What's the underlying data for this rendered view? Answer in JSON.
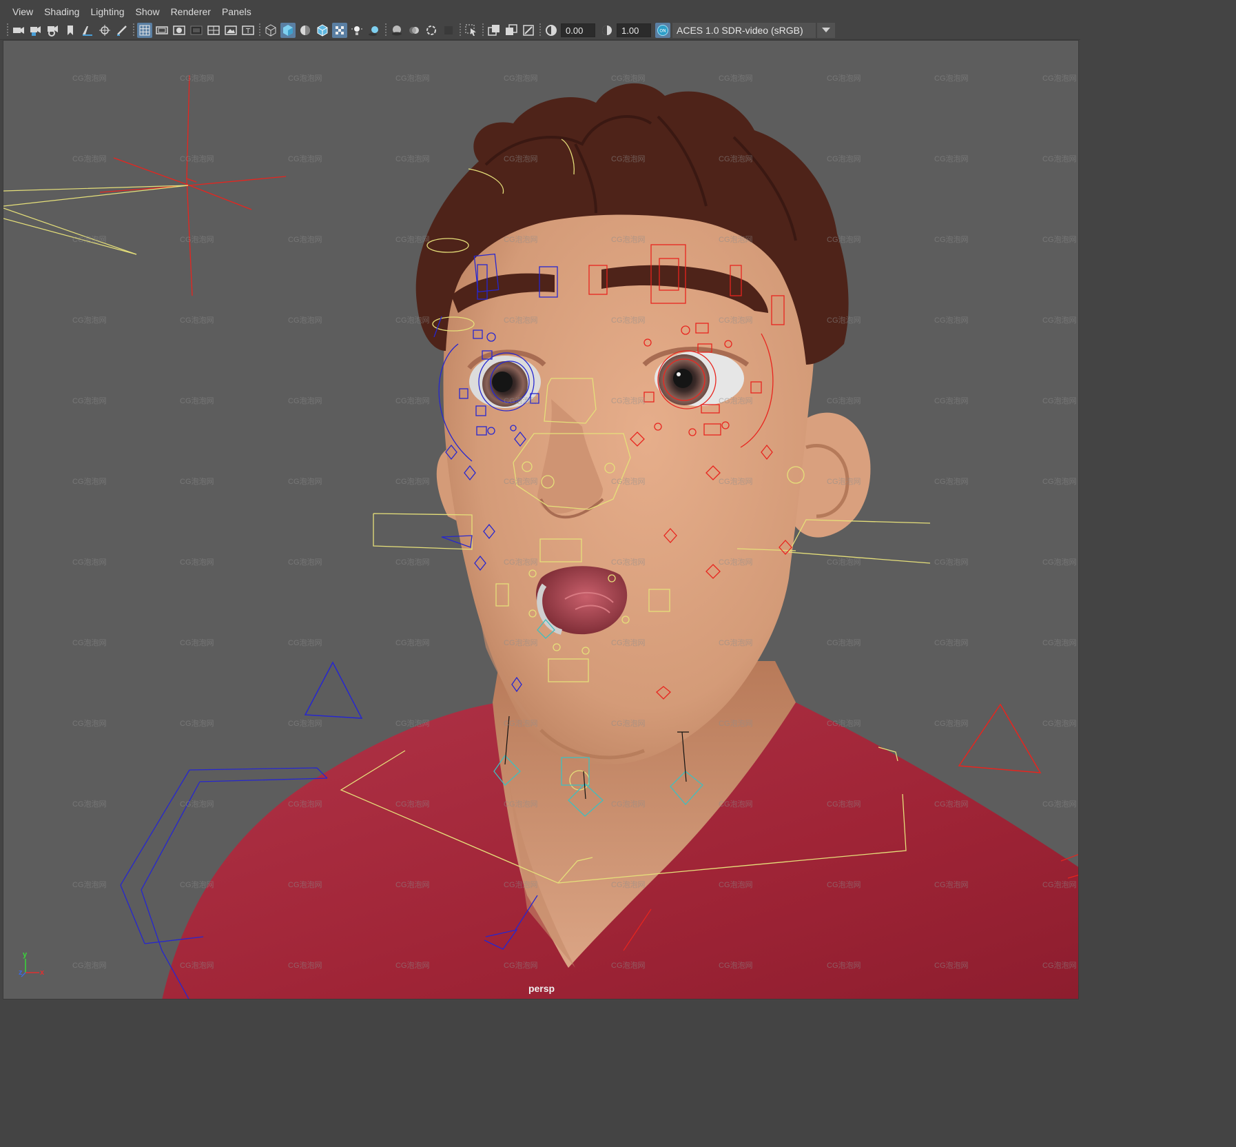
{
  "menus": [
    "View",
    "Shading",
    "Lighting",
    "Show",
    "Renderer",
    "Panels"
  ],
  "toolbar": {
    "exposure_value": "0.00",
    "gamma_value": "1.00",
    "color_management_badge": "ON",
    "color_space": "ACES 1.0 SDR-video (sRGB)",
    "icons": [
      "camera-icon",
      "camera-attributes-icon",
      "camera-settings-icon",
      "bookmark-icon",
      "image-plane-icon",
      "grid-snap-icon",
      "grease-pencil-icon",
      "grid-icon",
      "film-gate-icon",
      "resolution-gate-icon",
      "gate-mask-icon",
      "field-chart-icon",
      "safe-action-icon",
      "safe-title-icon",
      "wireframe-icon",
      "smooth-shade-icon",
      "use-default-material-icon",
      "wireframe-on-shaded-icon",
      "textured-icon",
      "use-all-lights-icon",
      "shadows-icon",
      "screen-space-ao-icon",
      "motion-blur-icon",
      "anti-aliasing-icon",
      "depth-of-field-icon",
      "select-camera-icon",
      "isolate-select-icon",
      "xray-icon",
      "xray-joints-icon",
      "exposure-icon",
      "gamma-icon"
    ]
  },
  "viewport": {
    "camera_label": "persp",
    "watermark_text": "CG泡泡网",
    "axis": {
      "y": "y",
      "z": "z",
      "x": "x"
    }
  },
  "colors": {
    "viewport_bg": "#5d5d5d",
    "skin": "#d9a07e",
    "hair": "#4e2319",
    "shirt": "#a3283a",
    "ctrl_red": "#e8241e",
    "ctrl_blue": "#2626d0",
    "ctrl_yellow": "#e6e07a",
    "ctrl_cyan": "#3fbfbf",
    "toolbar_active": "#5a7fa3"
  }
}
